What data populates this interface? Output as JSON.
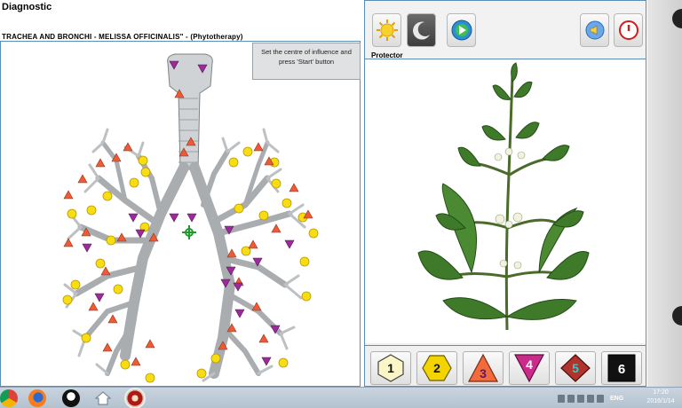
{
  "app": {
    "title": "Diagnostic",
    "subtitle": "TRACHEA AND BRONCHI - MELISSA OFFICINALIS\" - (Phytotherapy)"
  },
  "instruction": "Set the centre of influence and press 'Start' button",
  "toolbar": {
    "buttons": [
      {
        "icon": "sun-icon"
      },
      {
        "icon": "moon-icon"
      },
      {
        "icon": "play-forward-icon"
      },
      {
        "icon": "sound-icon"
      },
      {
        "icon": "power-icon"
      }
    ],
    "protector_label": "Protector"
  },
  "levels": [
    {
      "label": "1",
      "shape": "hexagon",
      "fill": "#fbf6c8"
    },
    {
      "label": "2",
      "shape": "hexagon",
      "fill": "#f4d400"
    },
    {
      "label": "3",
      "shape": "triangle-up",
      "fill": "#f26b3c"
    },
    {
      "label": "4",
      "shape": "triangle-down",
      "fill": "#cc2a8a"
    },
    {
      "label": "5",
      "shape": "diamond",
      "fill": "#b0342c"
    },
    {
      "label": "6",
      "shape": "square",
      "fill": "#111111"
    }
  ],
  "marker_colors": {
    "hexagon": "#f7dd12",
    "triangle_up": "#ee5a33",
    "triangle_down": "#9b2a9b"
  },
  "taskbar": {
    "apps": [
      "chrome-icon",
      "firefox-icon",
      "qq-icon",
      "home-icon",
      "diagnostic-app-icon"
    ],
    "language": "ENG",
    "time": "17:20",
    "date": "2016/1/14"
  }
}
